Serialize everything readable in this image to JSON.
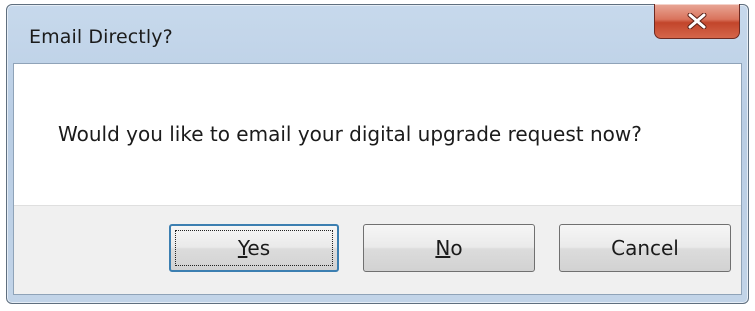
{
  "window": {
    "title": "Email Directly?",
    "close_icon": "close-icon"
  },
  "message": {
    "text": "Would you like to email your digital upgrade request now?"
  },
  "buttons": {
    "yes": {
      "mnemonic": "Y",
      "rest": "es"
    },
    "no": {
      "mnemonic": "N",
      "rest": "o"
    },
    "cancel": {
      "label": "Cancel"
    }
  },
  "colors": {
    "title_bar": "#c2d4e8",
    "close_button": "#c2452b",
    "default_button_border": "#3c7fb1"
  }
}
